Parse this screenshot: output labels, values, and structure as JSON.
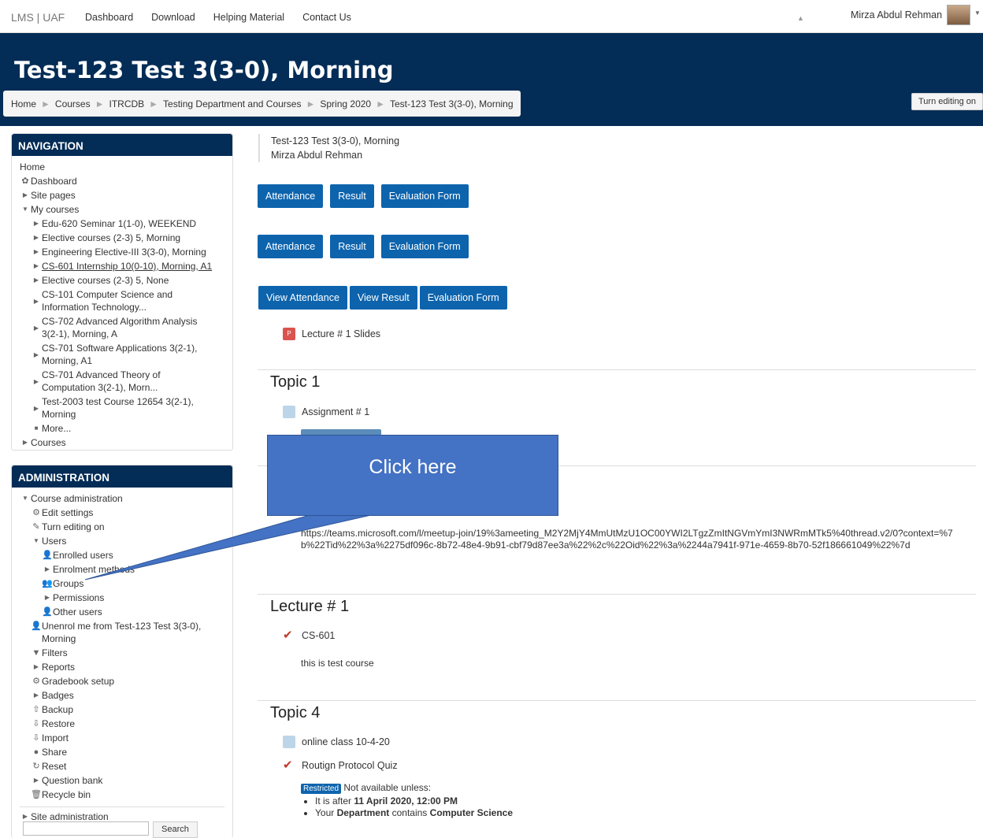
{
  "topbar": {
    "brand": "LMS | UAF",
    "nav": [
      "Dashboard",
      "Download",
      "Helping Material",
      "Contact Us"
    ],
    "user_name": "Mirza Abdul Rehman"
  },
  "header": {
    "title": "Test-123 Test 3(3-0), Morning",
    "breadcrumb": [
      "Home",
      "Courses",
      "ITRCDB",
      "Testing Department and Courses",
      "Spring 2020",
      "Test-123 Test 3(3-0), Morning"
    ],
    "editing_button": "Turn editing on"
  },
  "navigation": {
    "title": "NAVIGATION",
    "home": "Home",
    "dashboard": "Dashboard",
    "site_pages": "Site pages",
    "my_courses": "My courses",
    "courses_list": [
      "Edu-620 Seminar 1(1-0), WEEKEND",
      "Elective courses (2-3) 5, Morning",
      "Engineering Elective-III 3(3-0), Morning",
      "CS-601 Internship 10(0-10), Morning, A1",
      "Elective courses (2-3) 5, None",
      "CS-101 Computer Science and Information Technology...",
      "CS-702 Advanced Algorithm Analysis 3(2-1), Morning, A",
      "CS-701 Software Applications 3(2-1), Morning, A1",
      "CS-701 Advanced Theory of Computation 3(2-1), Morn...",
      "Test-2003 test Course 12654 3(2-1), Morning"
    ],
    "more": "More...",
    "courses": "Courses"
  },
  "administration": {
    "title": "ADMINISTRATION",
    "course_admin": "Course administration",
    "edit_settings": "Edit settings",
    "turn_editing_on": "Turn editing on",
    "users": "Users",
    "enrolled_users": "Enrolled users",
    "enrolment_methods": "Enrolment methods",
    "groups": "Groups",
    "permissions": "Permissions",
    "other_users": "Other users",
    "unenrol": "Unenrol me from Test-123 Test 3(3-0), Morning",
    "filters": "Filters",
    "reports": "Reports",
    "gradebook_setup": "Gradebook setup",
    "badges": "Badges",
    "backup": "Backup",
    "restore": "Restore",
    "import": "Import",
    "share": "Share",
    "reset": "Reset",
    "question_bank": "Question bank",
    "recycle_bin": "Recycle bin",
    "site_admin": "Site administration",
    "search_button": "Search"
  },
  "main": {
    "info_course": "Test-123 Test 3(3-0), Morning",
    "info_teacher": "Mirza Abdul Rehman",
    "row1": [
      "Attendance",
      "Result",
      "Evaluation Form"
    ],
    "row2": [
      "Attendance",
      "Result",
      "Evaluation Form"
    ],
    "row3": [
      "View Attendance",
      "View Result",
      "Evaluation Form"
    ],
    "lecture_slides": "Lecture # 1 Slides",
    "topic1_title": "Topic 1",
    "assignment": "Assignment # 1",
    "teams_link": "https://teams.microsoft.com/l/meetup-join/19%3ameeting_M2Y2MjY4MmUtMzU1OC00YWI2LTgzZmItNGVmYmI3NWRmMTk5%40thread.v2/0?context=%7b%22Tid%22%3a%2275df096c-8b72-48e4-9b91-cbf79d87ee3a%22%2c%22Oid%22%3a%2244a7941f-971e-4659-8b70-52f186661049%22%7d",
    "lecture1_title": "Lecture # 1",
    "cs601": "CS-601",
    "test_course_text": "this is test course",
    "topic4_title": "Topic 4",
    "online_class": "online class 10-4-20",
    "quiz": "Routign Protocol Quiz",
    "restricted_badge": "Restricted",
    "not_available": "Not available unless:",
    "cond1_prefix": "It is after ",
    "cond1_date": "11 April 2020, 12:00 PM",
    "cond2_prefix": "Your ",
    "cond2_field": "Department",
    "cond2_mid": " contains ",
    "cond2_value": "Computer Science"
  },
  "callout": {
    "text": "Click here"
  }
}
